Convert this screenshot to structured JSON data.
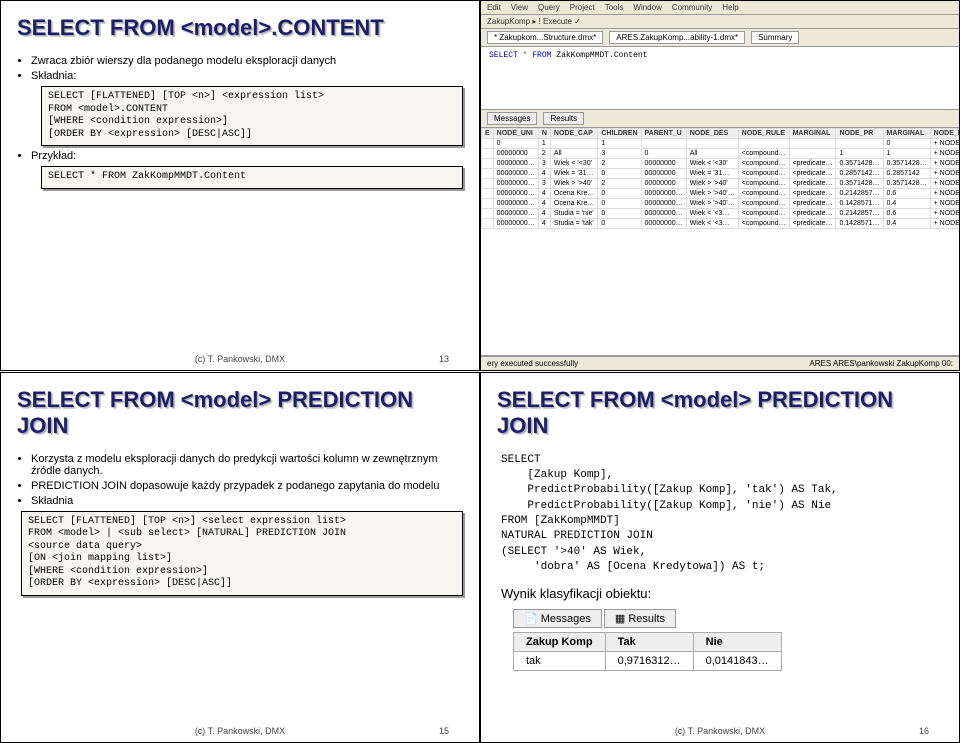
{
  "slide13": {
    "title": "SELECT FROM <model>.CONTENT",
    "b1": "Zwraca zbiór wierszy dla podanego modelu eksploracji danych",
    "b2": "Składnia:",
    "code1": "SELECT [FLATTENED] [TOP <n>] <expression list>\nFROM <model>.CONTENT\n[WHERE <condition expression>]\n[ORDER BY <expression> [DESC|ASC]]",
    "b3": "Przykład:",
    "code2": "SELECT * FROM ZakKompMMDT.Content",
    "footer": "(c) T. Pankowski, DMX",
    "page": "13"
  },
  "slide14": {
    "menu": [
      "Edit",
      "View",
      "Query",
      "Project",
      "Tools",
      "Window",
      "Community",
      "Help"
    ],
    "toolbar": "ZakupKomp   ▸ ! Execute  ✓",
    "tab1": "* Zakupkom...Structure.dmx*",
    "tab2": "ARES.ZakupKomp...ability-1.dmx*",
    "tab3": "Summary",
    "query": "SELECT * FROM ZakKompMMDT.Content",
    "msgs": "Messages",
    "results": "Results",
    "cols": [
      "E",
      "NODE_UNI",
      "N",
      "NODE_CAP",
      "CHILDREN",
      "PARENT_U",
      "NODE_DES",
      "NODE_RULE",
      "MARGINAL",
      "NODE_PR",
      "MARGINAL",
      "NODE_DISTRIBUTION"
    ],
    "rows": [
      [
        "",
        "0",
        "1",
        "",
        "1",
        "",
        "",
        "",
        "",
        "",
        "0",
        "+ NODE_DISTRIBUTION"
      ],
      [
        "",
        "00000000",
        "2",
        "All",
        "3",
        "0",
        "All",
        "<compound…",
        "",
        "1",
        "1",
        "+ NODE_DISTRIBUTION"
      ],
      [
        "",
        "00000000…",
        "3",
        "Wiek < '<30'",
        "2",
        "00000000",
        "Wiek < '<30'",
        "<compound…",
        "<predicate…",
        "0.3571428…",
        "0.3571428…",
        "+ NODE_DISTRIBUTION"
      ],
      [
        "",
        "00000000…",
        "4",
        "Wiek = '31…",
        "0",
        "00000000",
        "Wiek = '31…",
        "<compound…",
        "<predicate…",
        "0.2857142…",
        "0.2857142",
        "+ NODE_DISTRIBUTION"
      ],
      [
        "",
        "00000000…",
        "3",
        "Wiek > '>40'",
        "2",
        "00000000",
        "Wiek > '>40'",
        "<compound…",
        "<predicate…",
        "0.3571428…",
        "0.3571428…",
        "+ NODE_DISTRIBUTION"
      ],
      [
        "",
        "00000000…",
        "4",
        "Ocena Kre…",
        "0",
        "00000000…",
        "Wiek > '>40'…",
        "<compound…",
        "<predicate…",
        "0.2142857…",
        "0.6",
        "+ NODE_DISTRIBUTION"
      ],
      [
        "",
        "00000000…",
        "4",
        "Ocena Kre…",
        "0",
        "00000000…",
        "Wiek > '>40'…",
        "<compound…",
        "<predicate…",
        "0.1428571…",
        "0.4",
        "+ NODE_DISTRIBUTION"
      ],
      [
        "",
        "00000000…",
        "4",
        "Studia = 'nie'",
        "0",
        "00000000…",
        "Wiek < '<3…",
        "<compound…",
        "<predicate…",
        "0.2142857…",
        "0.6",
        "+ NODE_DISTRIBUTION"
      ],
      [
        "",
        "00000000…",
        "4",
        "Studia = 'tak'",
        "0",
        "00000000…",
        "Wiek < '<3…",
        "<compound…",
        "<predicate…",
        "0.1428571…",
        "0.4",
        "+ NODE_DISTRIBUTION"
      ]
    ],
    "status_left": "ery executed successfully",
    "status_right": "ARES ARES\\pankowski  ZakupKomp  00:"
  },
  "slide15": {
    "title": "SELECT FROM <model> PREDICTION JOIN",
    "b1": "Korzysta z modelu eksploracji danych do predykcji wartości kolumn w zewnętrznym źródle danych.",
    "b2": "PREDICTION JOIN dopasowuje każdy przypadek z podanego zapytania do modelu",
    "b3": "Składnia",
    "code": "SELECT [FLATTENED] [TOP <n>] <select expression list>\nFROM <model> | <sub select> [NATURAL] PREDICTION JOIN\n<source data query>\n[ON <join mapping list>]\n[WHERE <condition expression>]\n[ORDER BY <expression> [DESC|ASC]]",
    "footer": "(c) T. Pankowski, DMX",
    "page": "15"
  },
  "slide16": {
    "title": "SELECT FROM <model> PREDICTION JOIN",
    "code": "SELECT\n    [Zakup Komp],\n    PredictProbability([Zakup Komp], 'tak') AS Tak,\n    PredictProbability([Zakup Komp], 'nie') AS Nie\nFROM [ZakKompMMDT]\nNATURAL PREDICTION JOIN\n(SELECT '>40' AS Wiek,\n     'dobra' AS [Ocena Kredytowa]) AS t;",
    "wynik": "Wynik klasyfikacji obiektu:",
    "tab_msgs": "Messages",
    "tab_res": "Results",
    "th1": "Zakup Komp",
    "th2": "Tak",
    "th3": "Nie",
    "td1": "tak",
    "td2": "0,9716312…",
    "td3": "0,0141843…",
    "footer": "(c) T. Pankowski, DMX",
    "page": "16"
  }
}
